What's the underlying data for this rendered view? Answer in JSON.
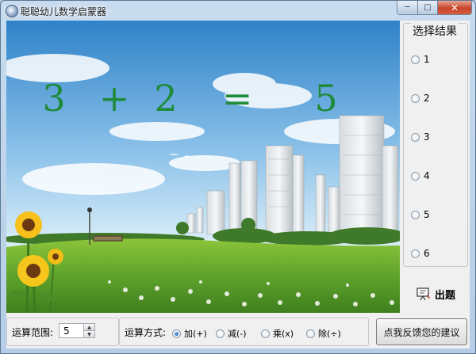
{
  "window": {
    "title": "聪聪幼儿数学启蒙器",
    "icon": "app-icon",
    "controls": {
      "minimize": "minimize-icon",
      "maximize": "maximize-icon",
      "close": "close-icon"
    }
  },
  "equation": {
    "operand1": "3",
    "operator": "+",
    "operand2": "2",
    "equals": "=",
    "answer": "5",
    "color": "#1f8a3a"
  },
  "result_panel": {
    "title": "选择结果",
    "options": [
      {
        "label": "1",
        "selected": false
      },
      {
        "label": "2",
        "selected": false
      },
      {
        "label": "3",
        "selected": false
      },
      {
        "label": "4",
        "selected": false
      },
      {
        "label": "5",
        "selected": false
      },
      {
        "label": "6",
        "selected": false
      }
    ]
  },
  "quiz_button": {
    "label": "出题",
    "icon": "question-board-icon"
  },
  "range": {
    "label": "运算范围:",
    "value": "5"
  },
  "operation": {
    "label": "运算方式:",
    "options": [
      {
        "label": "加(+)",
        "selected": true
      },
      {
        "label": "减(-)",
        "selected": false
      },
      {
        "label": "乘(x)",
        "selected": false
      },
      {
        "label": "除(÷)",
        "selected": false
      }
    ]
  },
  "feedback_button": {
    "label": "点我反馈您的建议"
  },
  "colors": {
    "frame": "#b5cde6",
    "close_button": "#c8442b",
    "selected_radio": "#134f9e"
  }
}
